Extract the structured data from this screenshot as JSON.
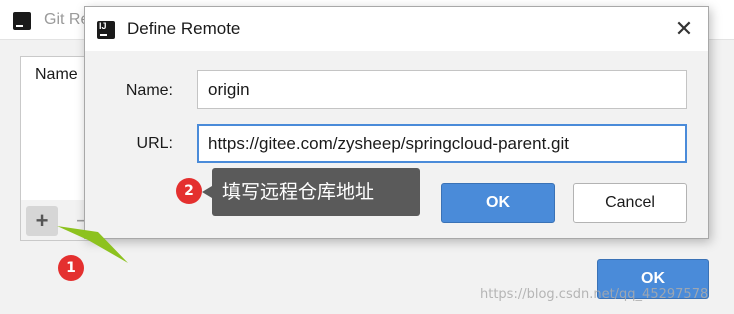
{
  "background_window": {
    "title": "Git Re",
    "list_header": "Name",
    "add_label": "+",
    "remove_label": "−",
    "ok_label": "OK"
  },
  "dialog": {
    "title": "Define Remote",
    "close_label": "✕",
    "name_label": "Name:",
    "name_value": "origin",
    "url_label": "URL:",
    "url_value": "https://gitee.com/zysheep/springcloud-parent.git",
    "ok_label": "OK",
    "cancel_label": "Cancel"
  },
  "annotations": {
    "badge_1": "1",
    "badge_2": "2",
    "callout_text": "填写远程仓库地址",
    "arrow_color": "#8dc21f",
    "badge_color": "#e4302f"
  },
  "watermark": "https://blog.csdn.net/qq_45297578",
  "colors": {
    "accent": "#4a8bd9",
    "callout_bg": "#5a5a5a"
  }
}
